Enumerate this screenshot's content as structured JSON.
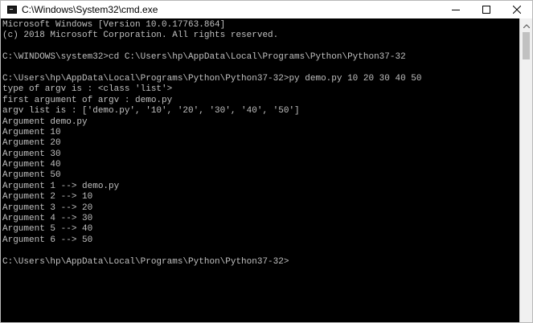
{
  "window": {
    "title": "C:\\Windows\\System32\\cmd.exe",
    "controls": {
      "minimize_icon": "minimize-icon",
      "maximize_icon": "maximize-icon",
      "close_icon": "close-icon"
    }
  },
  "console": {
    "lines": [
      "Microsoft Windows [Version 10.0.17763.864]",
      "(c) 2018 Microsoft Corporation. All rights reserved.",
      "",
      "C:\\WINDOWS\\system32>cd C:\\Users\\hp\\AppData\\Local\\Programs\\Python\\Python37-32",
      "",
      "C:\\Users\\hp\\AppData\\Local\\Programs\\Python\\Python37-32>py demo.py 10 20 30 40 50",
      "type of argv is : <class 'list'>",
      "first argument of argv : demo.py",
      "argv list is : ['demo.py', '10', '20', '30', '40', '50']",
      "Argument demo.py",
      "Argument 10",
      "Argument 20",
      "Argument 30",
      "Argument 40",
      "Argument 50",
      "Argument 1 --> demo.py",
      "Argument 2 --> 10",
      "Argument 3 --> 20",
      "Argument 4 --> 30",
      "Argument 5 --> 40",
      "Argument 6 --> 50",
      "",
      "C:\\Users\\hp\\AppData\\Local\\Programs\\Python\\Python37-32>"
    ]
  },
  "colors": {
    "console_background": "#000000",
    "console_text": "#c0c0c0",
    "titlebar_background": "#ffffff"
  }
}
